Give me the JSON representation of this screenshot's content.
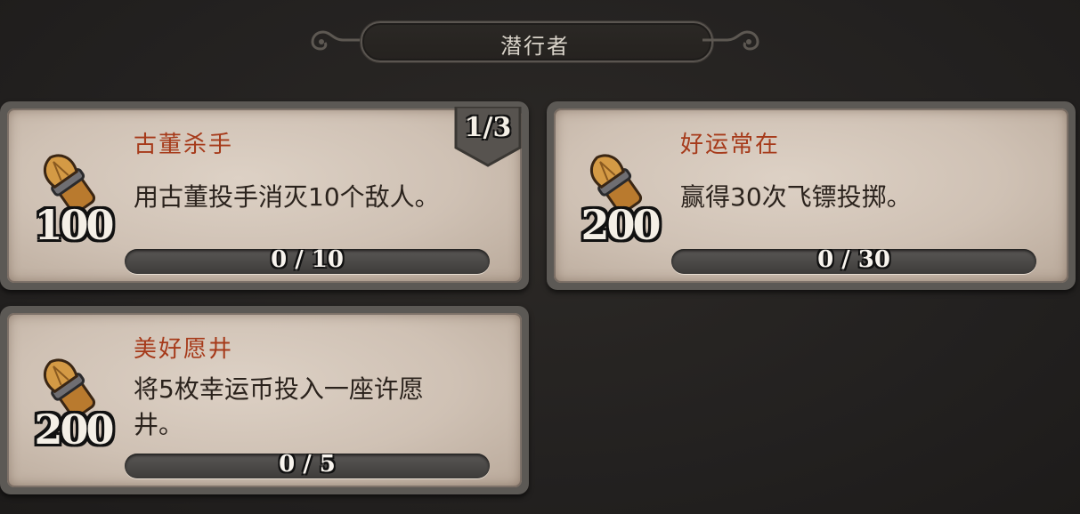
{
  "header": {
    "title": "潜行者"
  },
  "quests": [
    {
      "name": "古董杀手",
      "description": "用古董投手消灭10个敌人。",
      "reward": "100",
      "progress_text": "0 / 10",
      "progress_fraction": 0,
      "pagination": "1/3"
    },
    {
      "name": "好运常在",
      "description": "赢得30次飞镖投掷。",
      "reward": "200",
      "progress_text": "0 / 30",
      "progress_fraction": 0
    },
    {
      "name": "美好愿井",
      "description": "将5枚幸运币投入一座许愿井。",
      "reward": "200",
      "progress_text": "0 / 5",
      "progress_fraction": 0
    }
  ],
  "colors": {
    "quest_name": "#a63a1a",
    "parchment": "#d6c9bc",
    "frame": "#5c5955",
    "background": "#262321"
  },
  "icons": {
    "reward": "reward-pouch-icon"
  }
}
